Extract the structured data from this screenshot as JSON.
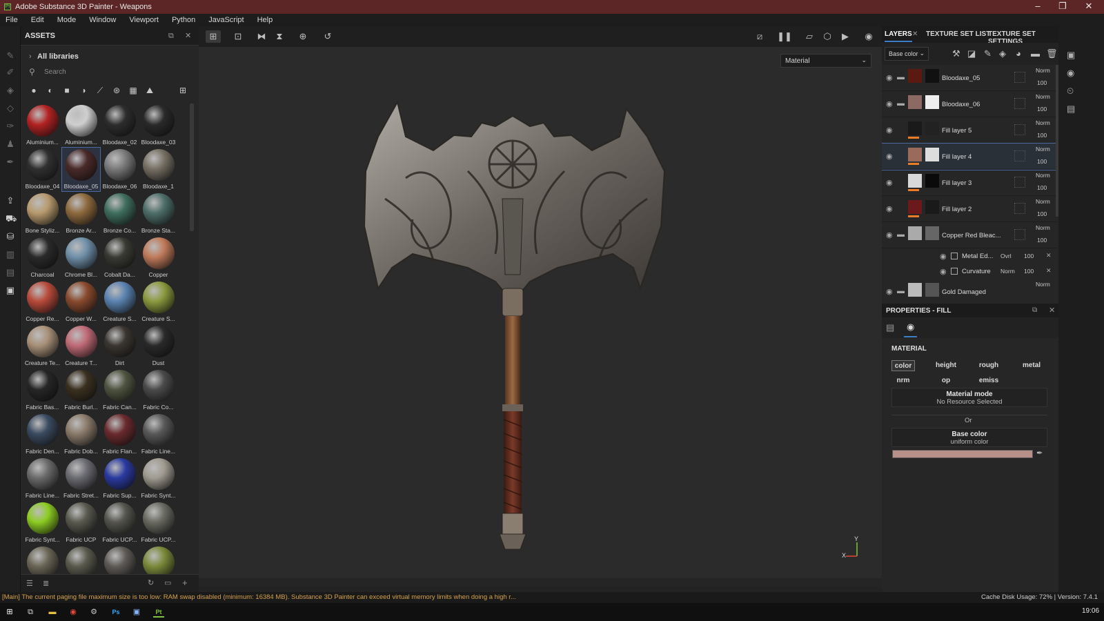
{
  "window": {
    "title": "Adobe Substance 3D Painter - Weapons"
  },
  "menu": [
    "File",
    "Edit",
    "Mode",
    "Window",
    "Viewport",
    "Python",
    "JavaScript",
    "Help"
  ],
  "assets": {
    "title": "ASSETS",
    "breadcrumb": "All libraries",
    "search_placeholder": "Search",
    "items": [
      {
        "label": "Aluminium...",
        "color": "#b22222"
      },
      {
        "label": "Aluminium...",
        "color": "#cfcfcf"
      },
      {
        "label": "Bloodaxe_02",
        "color": "#2d2d2d"
      },
      {
        "label": "Bloodaxe_03",
        "color": "#2a2a2a"
      },
      {
        "label": "Bloodaxe_04",
        "color": "#303030"
      },
      {
        "label": "Bloodaxe_05",
        "color": "#4a2a2a",
        "selected": true
      },
      {
        "label": "Bloodaxe_06",
        "color": "#7a7a7a"
      },
      {
        "label": "Bloodaxe_1",
        "color": "#777064"
      },
      {
        "label": "Bone Styliz...",
        "color": "#b89a6e"
      },
      {
        "label": "Bronze Ar...",
        "color": "#8e6a3e"
      },
      {
        "label": "Bronze Co...",
        "color": "#3f6e5e"
      },
      {
        "label": "Bronze Sta...",
        "color": "#4e6e6a"
      },
      {
        "label": "Charcoal",
        "color": "#2a2a2a"
      },
      {
        "label": "Chrome Bl...",
        "color": "#6f8fa8"
      },
      {
        "label": "Cobalt Da...",
        "color": "#3a3a34"
      },
      {
        "label": "Copper",
        "color": "#c07a5a"
      },
      {
        "label": "Copper Re...",
        "color": "#b84a3a"
      },
      {
        "label": "Copper W...",
        "color": "#8a4a2e"
      },
      {
        "label": "Creature S...",
        "color": "#5a82b0"
      },
      {
        "label": "Creature S...",
        "color": "#8a9a3e"
      },
      {
        "label": "Creature Te...",
        "color": "#a89078"
      },
      {
        "label": "Creature T...",
        "color": "#c06a76"
      },
      {
        "label": "Dirt",
        "color": "#3a3530"
      },
      {
        "label": "Dust",
        "color": "#2a2a2a"
      },
      {
        "label": "Fabric Bas...",
        "color": "#262626"
      },
      {
        "label": "Fabric Burl...",
        "color": "#3a3020"
      },
      {
        "label": "Fabric Can...",
        "color": "#4e5440"
      },
      {
        "label": "Fabric Co...",
        "color": "#4a4a4a"
      },
      {
        "label": "Fabric Den...",
        "color": "#3a4a60"
      },
      {
        "label": "Fabric Dob...",
        "color": "#8a7a6a"
      },
      {
        "label": "Fabric Flan...",
        "color": "#6a2a2e"
      },
      {
        "label": "Fabric Line...",
        "color": "#585858"
      },
      {
        "label": "Fabric Line...",
        "color": "#6a6a6a"
      },
      {
        "label": "Fabric Stret...",
        "color": "#6a6a72"
      },
      {
        "label": "Fabric Sup...",
        "color": "#2a3aa0"
      },
      {
        "label": "Fabric Synt...",
        "color": "#a09a90"
      },
      {
        "label": "Fabric Synt...",
        "color": "#8ccc22"
      },
      {
        "label": "Fabric UCP",
        "color": "#5a5a50"
      },
      {
        "label": "Fabric UCP...",
        "color": "#55554e"
      },
      {
        "label": "Fabric UCP...",
        "color": "#6a6a62"
      },
      {
        "label": "",
        "color": "#6a6556"
      },
      {
        "label": "",
        "color": "#5a5a4e"
      },
      {
        "label": "",
        "color": "#5e5a56"
      },
      {
        "label": "",
        "color": "#7a8a3a"
      }
    ]
  },
  "viewport": {
    "material_select": "Material",
    "axis_y": "Y",
    "axis_x": "X"
  },
  "layers_panel": {
    "tabs": [
      "LAYERS",
      "TEXTURE SET LIST",
      "TEXTURE SET SETTINGS"
    ],
    "channel_select": "Base color",
    "layers": [
      {
        "name": "Bloodaxe_05",
        "blend": "Norm",
        "opacity": "100",
        "thumb": "#5a1a12",
        "mask": "#111",
        "folder": true
      },
      {
        "name": "Bloodaxe_06",
        "blend": "Norm",
        "opacity": "100",
        "thumb": "#8a6a62",
        "mask": "#eee",
        "folder": true
      },
      {
        "name": "Fill layer 5",
        "blend": "Norm",
        "opacity": "100",
        "thumb": "#1a1a1a",
        "mask": "#222",
        "folder": false
      },
      {
        "name": "Fill layer 4",
        "blend": "Norm",
        "opacity": "100",
        "thumb": "#9a6a5a",
        "mask": "#ddd",
        "folder": false,
        "selected": true
      },
      {
        "name": "Fill layer 3",
        "blend": "Norm",
        "opacity": "100",
        "thumb": "#d8d8d8",
        "mask": "#0a0a0a",
        "folder": false
      },
      {
        "name": "Fill layer 2",
        "blend": "Norm",
        "opacity": "100",
        "thumb": "#6a1a1a",
        "mask": "#1a1a1a",
        "folder": false
      },
      {
        "name": "Copper Red Bleac...",
        "blend": "Norm",
        "opacity": "100",
        "thumb": "#aaa",
        "mask": "#666",
        "folder": true
      }
    ],
    "sublayers": [
      {
        "name": "Metal Ed...",
        "blend": "Ovrl",
        "opacity": "100"
      },
      {
        "name": "Curvature",
        "blend": "Norm",
        "opacity": "100"
      }
    ],
    "partial_layer": {
      "name": "Gold Damaged",
      "blend": "Norm"
    }
  },
  "properties": {
    "title": "PROPERTIES - FILL",
    "section": "MATERIAL",
    "channels": [
      "color",
      "height",
      "rough",
      "metal",
      "nrm",
      "op",
      "emiss"
    ],
    "material_mode_label": "Material mode",
    "material_mode_value": "No Resource Selected",
    "or_label": "Or",
    "base_color_label": "Base color",
    "base_color_value": "uniform color",
    "base_color_swatch": "#b8908a"
  },
  "status": {
    "message": "[Main] The current paging file maximum size is too low: RAM swap disabled (minimum: 16384 MB). Substance 3D Painter can exceed virtual memory limits when doing a high r...",
    "cache": "Cache Disk Usage:",
    "usage": "72% | Version: 7.4.1"
  },
  "taskbar": {
    "time": "19:06"
  }
}
